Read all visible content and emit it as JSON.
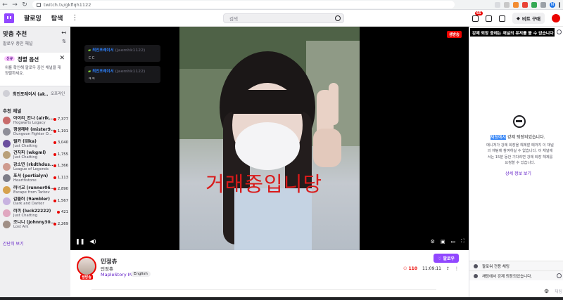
{
  "browser": {
    "url": "twitch.tv/gkflqh1122",
    "profile_initial": "N"
  },
  "topnav": {
    "following": "팔로잉",
    "browse": "탐색",
    "search_placeholder": "검색",
    "notif_count": "65",
    "buy_label": "비트 구매"
  },
  "sidebar": {
    "title": "맞춤 추천",
    "subtitle": "팔로우 중인 채널",
    "promo": {
      "badge": "신규",
      "title": "정렬 옵션",
      "body": "위를 확인해 팔로우 중인 채널을 재정렬하세요."
    },
    "followed": {
      "name": "최진포레이서 (ak...",
      "status": "오프라인"
    },
    "recommended_title": "추천 채널",
    "recommended": [
      {
        "name": "아이리_칸나 (airik...",
        "category": "Hogwarts Legacy",
        "viewers": "7,377",
        "color": "#c86b6b"
      },
      {
        "name": "갱생레바 (mister9...",
        "category": "Dungeon Fighter O...",
        "viewers": "1,191",
        "color": "#8f8f99"
      },
      {
        "name": "릴카 (lilka)",
        "category": "Just Chatting",
        "viewers": "3,040",
        "color": "#6b4f9e"
      },
      {
        "name": "건지피 (wkgml)",
        "category": "Just Chatting",
        "viewers": "1,755",
        "color": "#b9a07a"
      },
      {
        "name": "강소연 (rkdthdus...",
        "category": "League of Legends",
        "viewers": "1,366",
        "color": "#cf9b8f"
      },
      {
        "name": "포셔 (portialyn)",
        "category": "Hearthstone",
        "viewers": "1,113",
        "color": "#7d7d88"
      },
      {
        "name": "러너교 (runner06...",
        "category": "Escape from Tarkov",
        "viewers": "2,890",
        "color": "#d6a24e"
      },
      {
        "name": "감블러 (9ambler)",
        "category": "Dark and Darker",
        "viewers": "1,567",
        "color": "#c7b2e0"
      },
      {
        "name": "러끼 (luck22222)",
        "category": "Just Chatting",
        "viewers": "421",
        "color": "#e0a7c0"
      },
      {
        "name": "조니니 (johnny30...",
        "category": "Lost Ark",
        "viewers": "2,269",
        "color": "#a08f86"
      }
    ],
    "show_more": "간단히 보기"
  },
  "player": {
    "live_tag": "생방송",
    "overlay_text": "거래중입니당",
    "chat_messages": [
      {
        "user": "최진포레이서",
        "handle": "(jaemhk1122)",
        "text": "ㄷㄷ"
      },
      {
        "user": "최진포레이서",
        "handle": "(jaemhk1122)",
        "text": "ㅋㅋ"
      }
    ]
  },
  "channel": {
    "name": "민정츄",
    "title": "민정츄",
    "game": "MapleStory M",
    "language": "English",
    "live_badge": "생방송",
    "follow_label": "팔로우",
    "viewers": "110",
    "uptime": "11:09:11"
  },
  "chat": {
    "tooltip": "강제 퇴장 중에는 채널의 유저를 볼 수 없습니다",
    "ban_title_highlight": "채팅에서",
    "ban_title_rest": " 강제 퇴장되었습니다.",
    "ban_text": "매니저가 강제 회장을 해제할 때까지 이 채널의 채팅에 참여하실 수 없습니다. 이 채널에서는 15분 동안 기다리면 강제 퇴장 해제를 요청할 수 있습니다.",
    "ban_link": "상세 정보 보기",
    "followers_only": "팔로워 전용 채팅",
    "banned_notice": "채팅에서 강제 퇴장되었습니다.",
    "send_label": "채팅"
  },
  "colors": {
    "twitch_purple": "#9147ff",
    "live_red": "#eb0400",
    "link_purple": "#5c16c5"
  }
}
